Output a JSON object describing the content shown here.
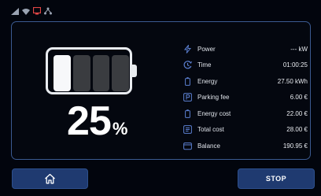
{
  "charge": {
    "percent_value": "25",
    "percent_unit": "%",
    "fraction": 0.25
  },
  "info": [
    {
      "icon": "lightning-icon",
      "label": "Power",
      "value": "--- kW"
    },
    {
      "icon": "clock-icon",
      "label": "Time",
      "value": "01:00:25"
    },
    {
      "icon": "battery-icon",
      "label": "Energy",
      "value": "27.50 kWh"
    },
    {
      "icon": "parking-icon",
      "label": "Parking fee",
      "value": "6.00 €"
    },
    {
      "icon": "battery-icon",
      "label": "Energy cost",
      "value": "22.00 €"
    },
    {
      "icon": "receipt-icon",
      "label": "Total cost",
      "value": "28.00 €"
    },
    {
      "icon": "wallet-icon",
      "label": "Balance",
      "value": "190.95 €"
    }
  ],
  "buttons": {
    "home_icon": "home-icon",
    "stop_label": "STOP"
  },
  "colors": {
    "accent": "#1f3a70",
    "panel_border": "#3b5a91",
    "icon_blue": "#5b7fd0"
  }
}
